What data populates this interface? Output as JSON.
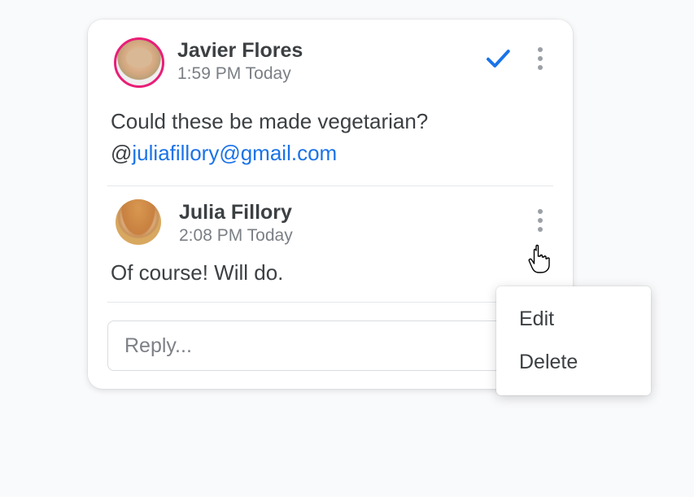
{
  "main_comment": {
    "author": "Javier Flores",
    "time": "1:59 PM Today",
    "body_text": "Could these be made vegetarian?",
    "mention_prefix": "@",
    "mention_email": "juliafillory@gmail.com"
  },
  "reply_comment": {
    "author": "Julia Fillory",
    "time": "2:08 PM Today",
    "body_text": "Of course! Will do."
  },
  "reply_input": {
    "placeholder": "Reply..."
  },
  "context_menu": {
    "edit": "Edit",
    "delete": "Delete"
  }
}
